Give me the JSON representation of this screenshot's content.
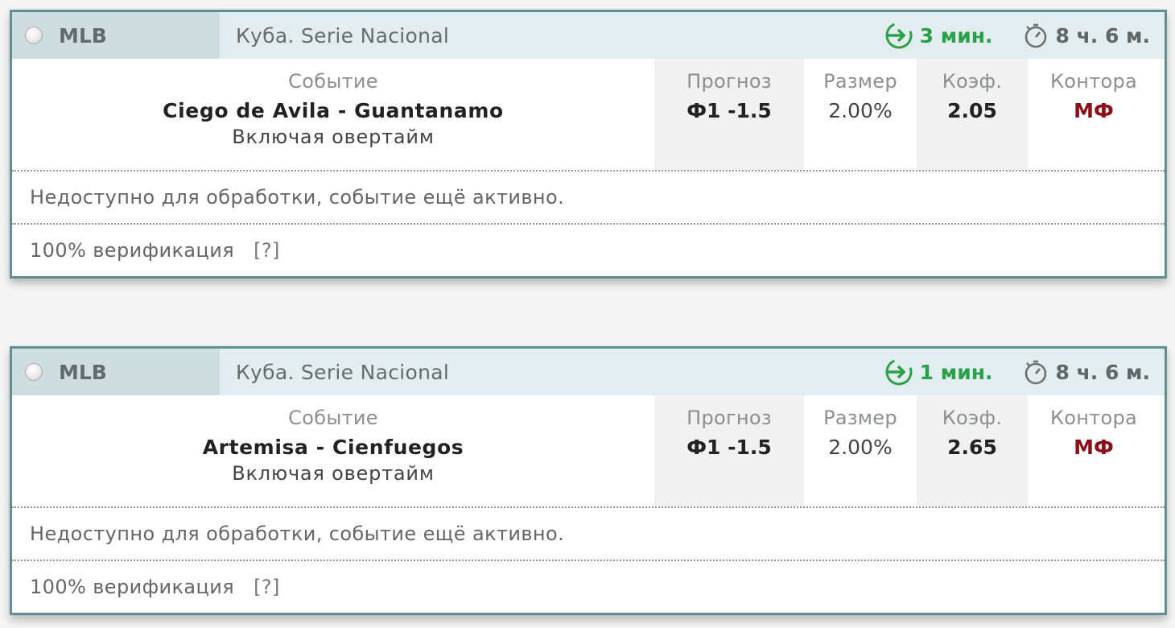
{
  "colors": {
    "card_border": "#5f8f91",
    "header_bg": "#e3ecee",
    "sport_bg": "#cfdde0",
    "start_green": "#2aa148",
    "bookmaker_red": "#8b0f16",
    "stripe_gray": "#f1f1f1"
  },
  "icons": {
    "radio": "radio-button-icon",
    "start": "arrow-enter-icon",
    "duration": "stopwatch-icon"
  },
  "columns": {
    "event": "Событие",
    "forecast": "Прогноз",
    "size": "Размер",
    "odds": "Коэф.",
    "bookmaker": "Контора"
  },
  "cards": [
    {
      "sport": "MLB",
      "league": "Куба. Serie Nacional",
      "starts_in": "3 мин.",
      "duration": "8 ч. 6 м.",
      "event": "Ciego de Avila - Guantanamo",
      "event_note": "Включая овертайм",
      "forecast": "Ф1 -1.5",
      "size": "2.00%",
      "odds": "2.05",
      "bookmaker": "МФ",
      "status": "Недоступно для обработки, событие ещё активно.",
      "verification": "100% верификация",
      "verification_help": "[?]"
    },
    {
      "sport": "MLB",
      "league": "Куба. Serie Nacional",
      "starts_in": "1 мин.",
      "duration": "8 ч. 6 м.",
      "event": "Artemisa - Cienfuegos",
      "event_note": "Включая овертайм",
      "forecast": "Ф1 -1.5",
      "size": "2.00%",
      "odds": "2.65",
      "bookmaker": "МФ",
      "status": "Недоступно для обработки, событие ещё активно.",
      "verification": "100% верификация",
      "verification_help": "[?]"
    }
  ]
}
